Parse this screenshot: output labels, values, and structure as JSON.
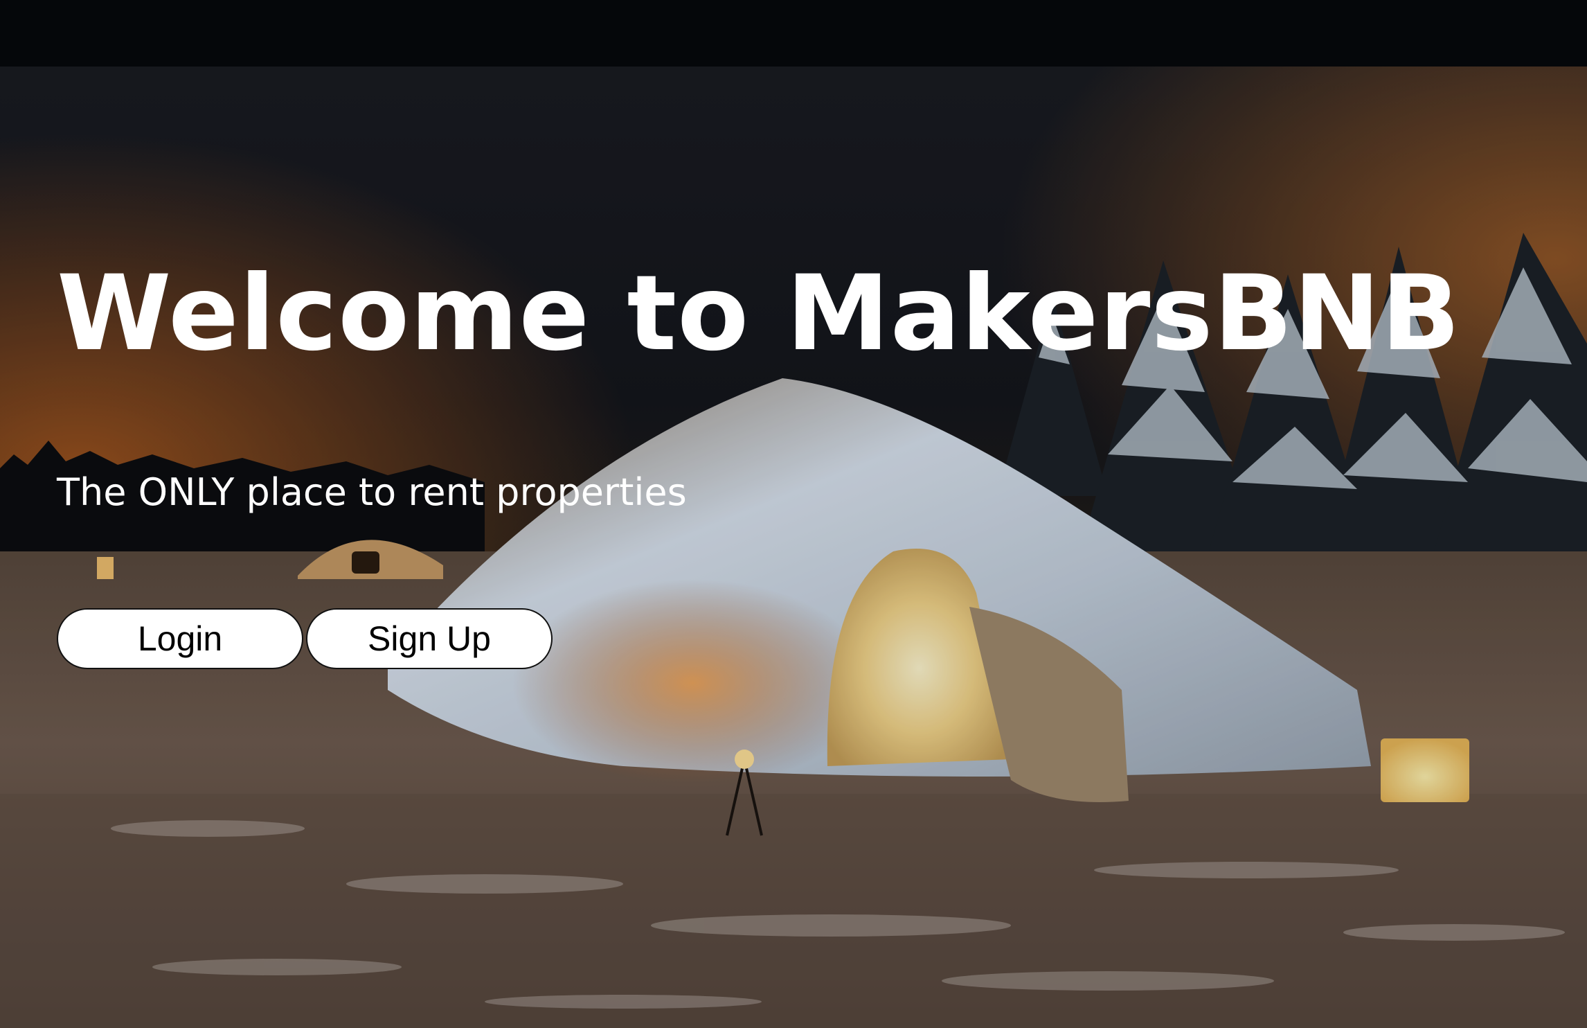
{
  "hero": {
    "title": "Welcome to MakersBNB",
    "subtitle": "The ONLY place to rent properties"
  },
  "actions": {
    "login_label": "Login",
    "signup_label": "Sign Up"
  },
  "colors": {
    "top_bar": "#05070a",
    "text": "#ffffff",
    "button_bg": "#ffffff",
    "button_text": "#000000"
  }
}
